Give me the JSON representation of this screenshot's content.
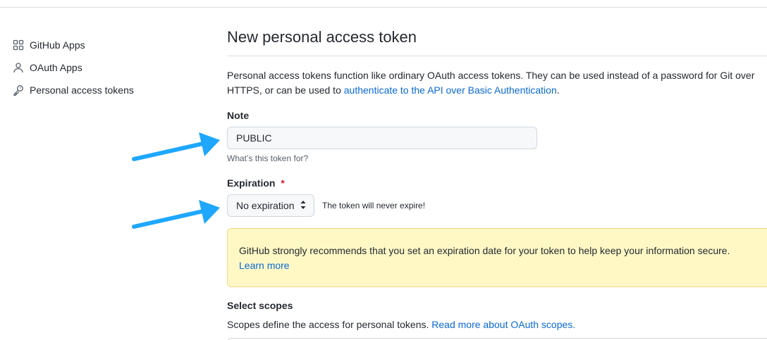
{
  "sidebar": {
    "items": [
      {
        "label": "GitHub Apps",
        "icon": "apps-icon"
      },
      {
        "label": "OAuth Apps",
        "icon": "person-icon"
      },
      {
        "label": "Personal access tokens",
        "icon": "key-icon"
      }
    ]
  },
  "main": {
    "title": "New personal access token",
    "intro_text": "Personal access tokens function like ordinary OAuth access tokens. They can be used instead of a password for Git over HTTPS, or can be used to ",
    "intro_link": "authenticate to the API over Basic Authentication",
    "intro_end": "."
  },
  "note": {
    "label": "Note",
    "value": "PUBLIC",
    "hint": "What’s this token for?"
  },
  "expiration": {
    "label": "Expiration",
    "required_mark": "*",
    "selected": "No expiration",
    "status": "The token will never expire!"
  },
  "warning": {
    "text": "GitHub strongly recommends that you set an expiration date for your token to help keep your information secure.",
    "link": "Learn more"
  },
  "scopes": {
    "title": "Select scopes",
    "desc": "Scopes define the access for personal tokens. ",
    "link": "Read more about OAuth scopes."
  },
  "colors": {
    "link": "#0969da",
    "warning_bg": "#fff8c5",
    "annotation_arrow": "#1ea7fd",
    "required": "#cf222e"
  }
}
